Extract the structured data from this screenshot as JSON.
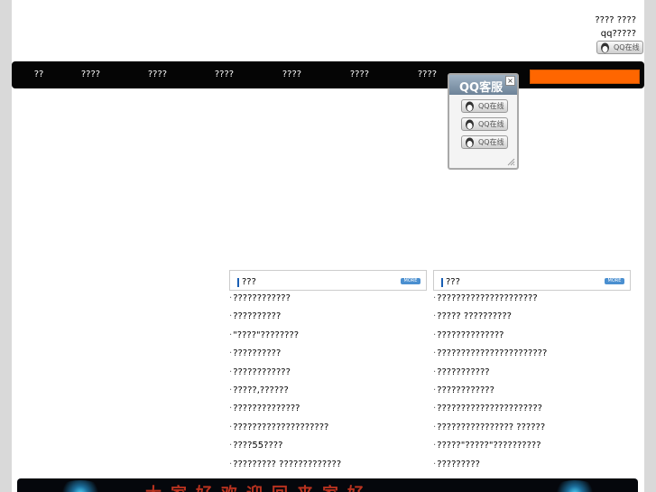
{
  "header": {
    "top_line_1": "???? ????",
    "top_line_2": "qq?????",
    "qq_button_label": "QQ在线"
  },
  "nav": {
    "items": [
      "??",
      "????",
      "????",
      "????",
      "????",
      "????",
      "????"
    ],
    "search_color": "#ff6600"
  },
  "qq_panel": {
    "title": "QQ客服",
    "close_label": "×",
    "rows": [
      "QQ在线",
      "QQ在线",
      "QQ在线"
    ]
  },
  "left_box": {
    "title": "???",
    "more_label": "MORE",
    "items": [
      "????????????",
      "??????????",
      "\"????\"????????",
      "??????????",
      "????????????",
      "?????,??????",
      "??????????????",
      "????????????????????",
      "????55????",
      "????????? ?????????????"
    ]
  },
  "right_box": {
    "title": "???",
    "more_label": "MORE",
    "items": [
      "?????????????????????",
      "????? ??????????",
      "??????????????",
      "???????????????????????",
      "???????????",
      "????????????",
      "??????????????????????",
      "???????????????? ??????",
      "?????\"?????\"??????????",
      "?????????"
    ]
  },
  "banner": {
    "text": "大家好欢迎回来家好"
  }
}
